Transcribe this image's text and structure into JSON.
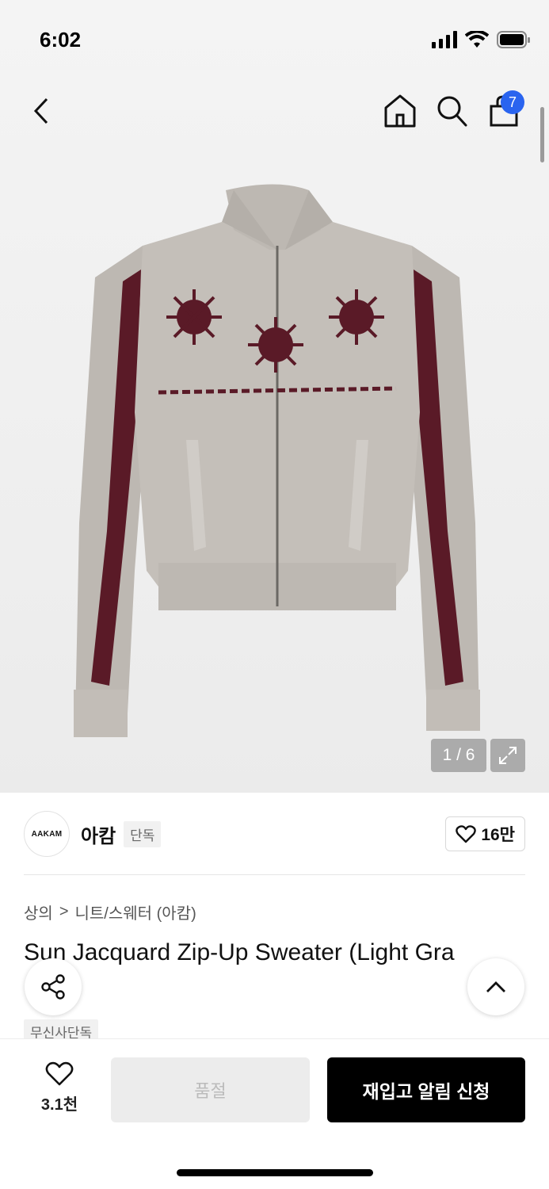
{
  "status_bar": {
    "time": "6:02"
  },
  "nav": {
    "cart_count": "7"
  },
  "gallery": {
    "counter": "1 / 6"
  },
  "brand": {
    "logo_text": "AAKAM",
    "name": "아캄",
    "tag": "단독",
    "likes": "16만"
  },
  "breadcrumb": {
    "category": "상의",
    "separator": ">",
    "subcategory": "니트/스웨터 (아캄)"
  },
  "product": {
    "title": "Sun Jacquard Zip-Up Sweater (Light Gra",
    "exclusive_tag": "무신사단독"
  },
  "bottom_bar": {
    "like_count": "3.1천",
    "soldout_label": "품절",
    "restock_label": "재입고 알림 신청"
  },
  "colors": {
    "accent_badge": "#2a64ef",
    "sweater_body": "#bdb8b2",
    "sweater_stripe": "#5a1a27"
  },
  "icons": [
    "back-arrow-icon",
    "home-icon",
    "search-icon",
    "bag-icon",
    "expand-icon",
    "heart-icon",
    "share-icon",
    "chevron-up-icon"
  ]
}
